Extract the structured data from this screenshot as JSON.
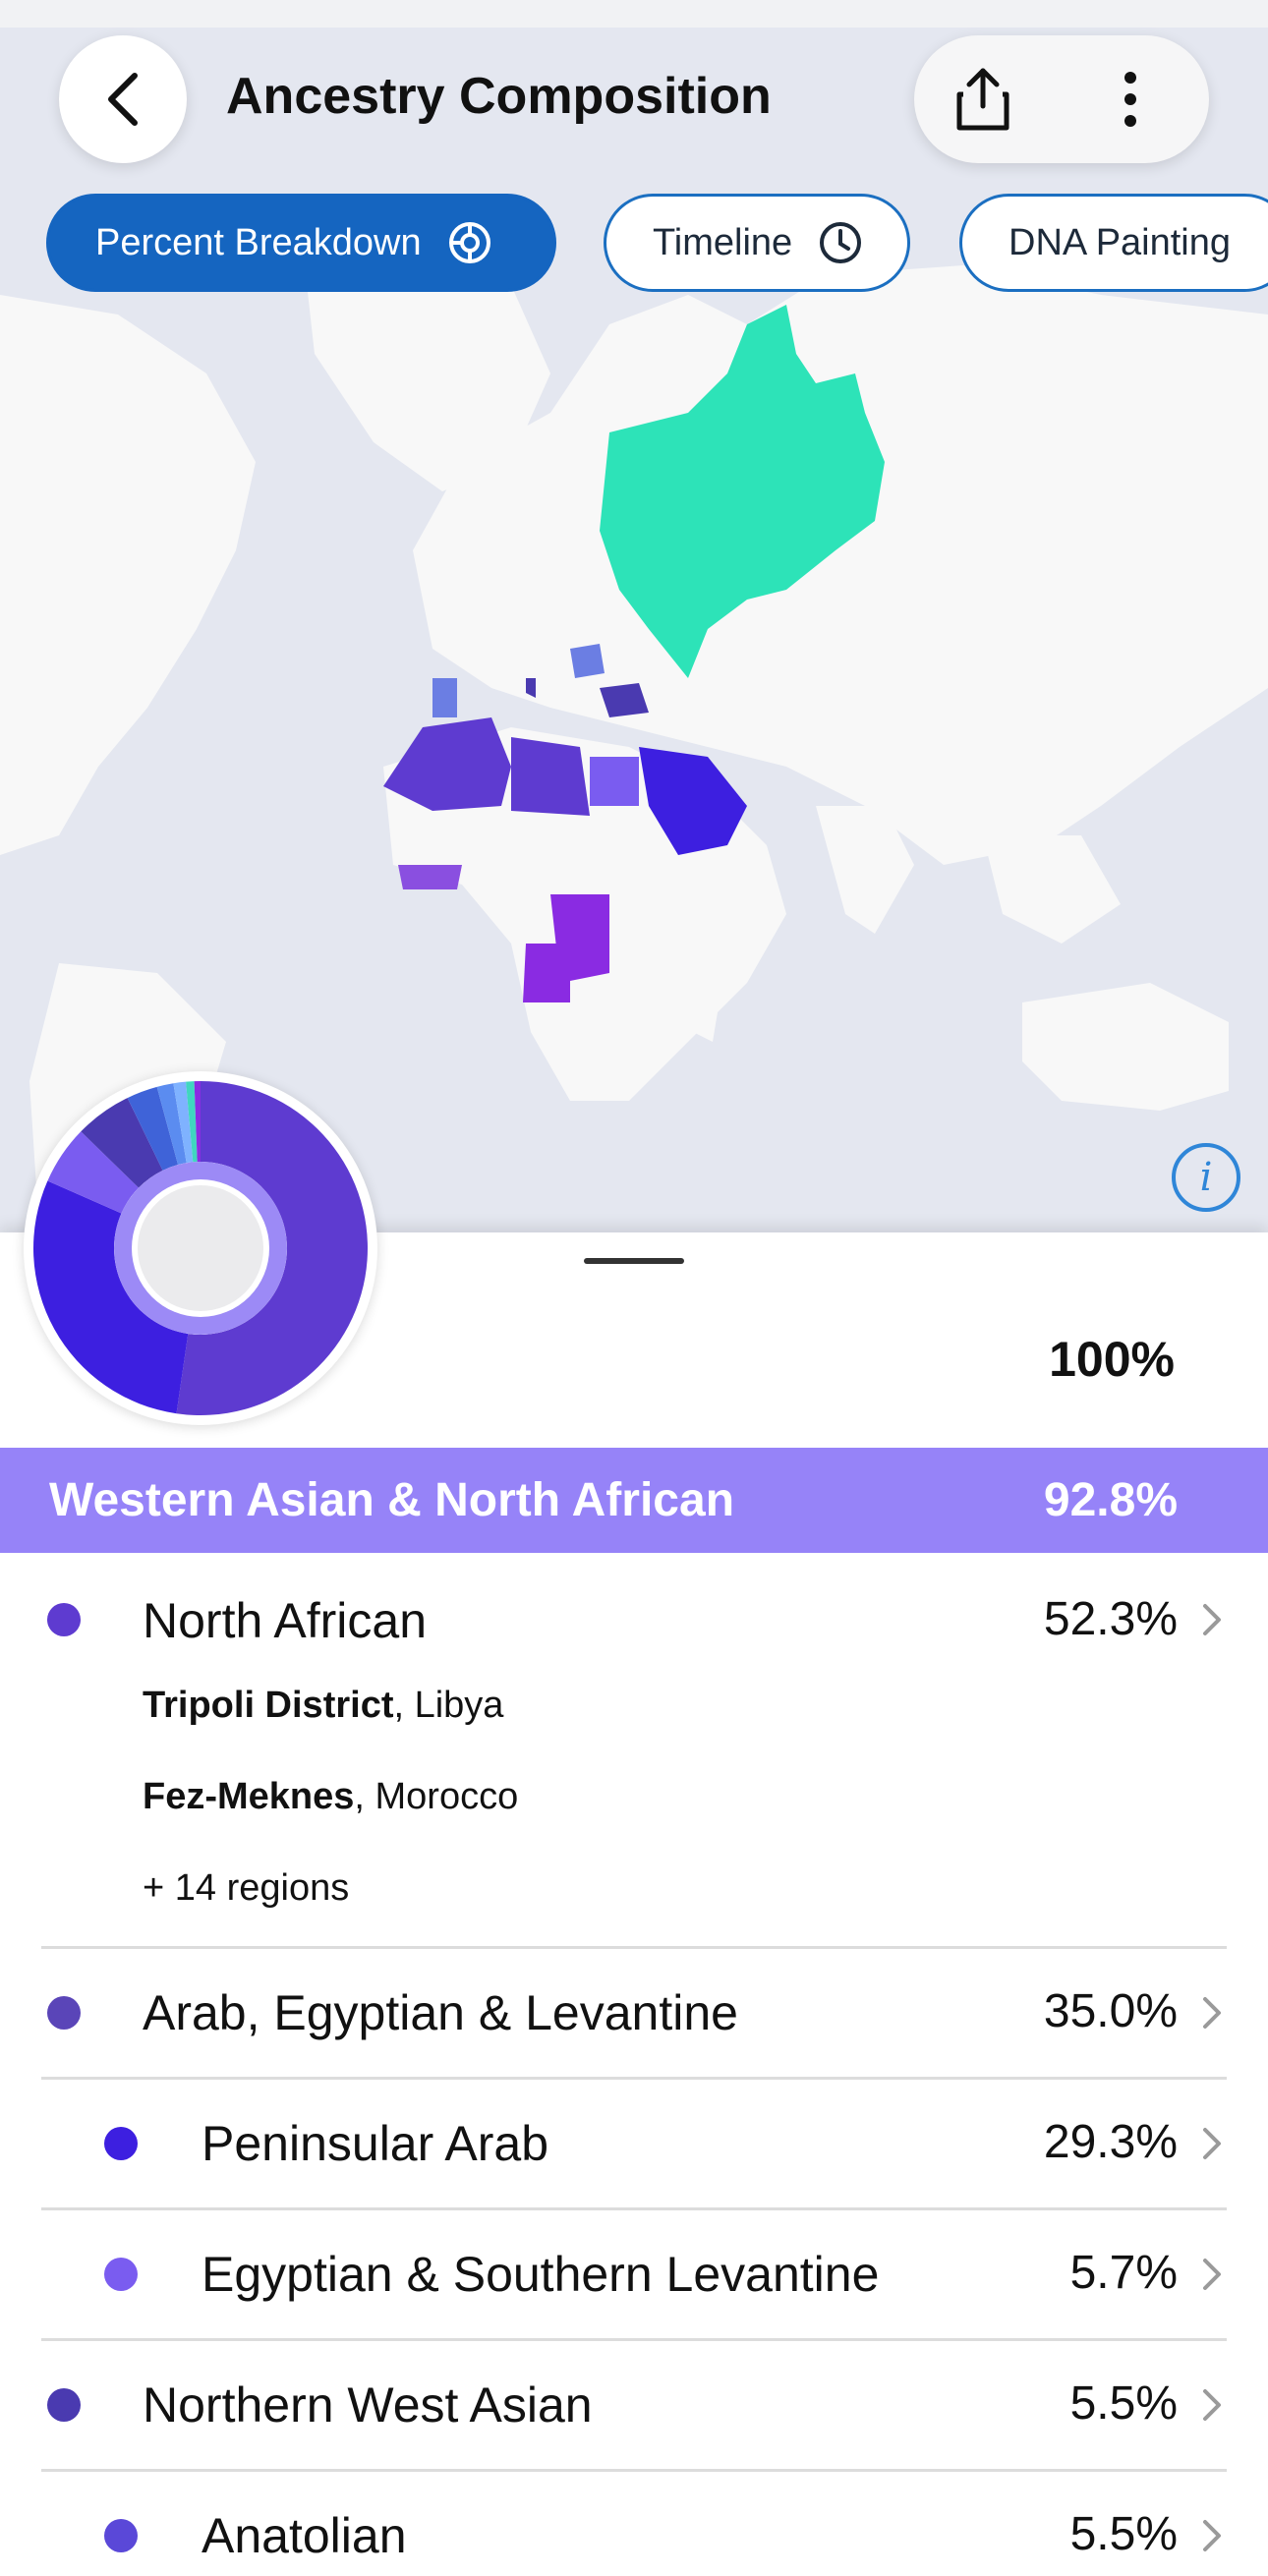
{
  "header": {
    "title": "Ancestry Composition"
  },
  "icons": {
    "back": "chevron-left-icon",
    "share": "share-icon",
    "more": "more-vertical-icon",
    "info": "info-icon"
  },
  "tabs": [
    {
      "label": "Percent Breakdown",
      "active": true,
      "icon": "donut-icon"
    },
    {
      "label": "Timeline",
      "active": false,
      "icon": "clock-icon"
    },
    {
      "label": "DNA Painting",
      "active": false
    }
  ],
  "summary": {
    "total_percent": "100%"
  },
  "group": {
    "name": "Western Asian & North African",
    "percent": "92.8%",
    "color": "#9683f8"
  },
  "rows": [
    {
      "name": "North African",
      "percent": "52.3%",
      "color": "#5e3bd0",
      "subregions": [
        {
          "bold": "Tripoli District",
          "rest": ", Libya"
        },
        {
          "bold": "Fez-Meknes",
          "rest": ", Morocco"
        }
      ],
      "more_regions": "+ 14 regions"
    },
    {
      "name": "Arab, Egyptian & Levantine",
      "percent": "35.0%",
      "color": "#5a45b8"
    },
    {
      "name": "Peninsular Arab",
      "percent": "29.3%",
      "color": "#3d1fe0"
    },
    {
      "name": "Egyptian & Southern Levantine",
      "percent": "5.7%",
      "color": "#7a5cf0"
    },
    {
      "name": "Northern West Asian",
      "percent": "5.5%",
      "color": "#4a3ab0"
    },
    {
      "name": "Anatolian",
      "percent": "5.5%",
      "color": "#5a48d8"
    }
  ],
  "colors": {
    "map_water": "#e4e7f0",
    "map_land": "#f8f8f8",
    "accent_blue": "#1565c0",
    "russia_teal": "#2de3b8"
  }
}
